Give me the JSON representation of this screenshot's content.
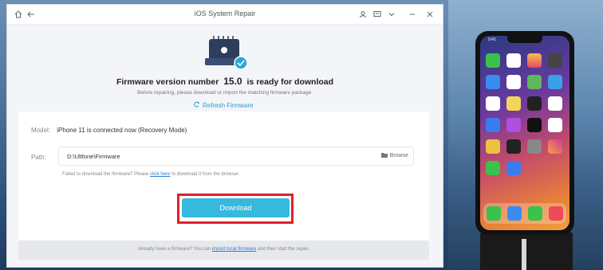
{
  "window": {
    "title": "iOS System Repair",
    "icons": [
      "home-icon",
      "back-arrow-icon",
      "user-icon",
      "feedback-icon",
      "chevron-down-icon",
      "minimize-icon",
      "close-icon"
    ]
  },
  "firmware": {
    "title_prefix": "Firmware version number",
    "version": "15.0",
    "title_suffix": "is ready for download",
    "subtitle": "Before repairing, please download or import the matching firmware package.",
    "refresh_label": "Refresh Firmware"
  },
  "panel": {
    "model_label": "Model:",
    "model_value": "iPhone 11 is connected now (Recovery Mode)",
    "path_label": "Path:",
    "path_value": "D:\\Ultfone\\Firmware",
    "browse_label": "Browse",
    "fail_prefix": "Failed to download the firmware? Please",
    "fail_link": "click here",
    "fail_suffix": "to download it from the browser.",
    "download_label": "Download"
  },
  "footer": {
    "prefix": "Already have a firmware? You can",
    "link": "import local firmware",
    "suffix": "and then start the repair."
  },
  "phone": {
    "time": "9:41"
  },
  "colors": {
    "accent": "#36b9dc",
    "highlight": "#e0202a",
    "link": "#2a7fd0"
  }
}
